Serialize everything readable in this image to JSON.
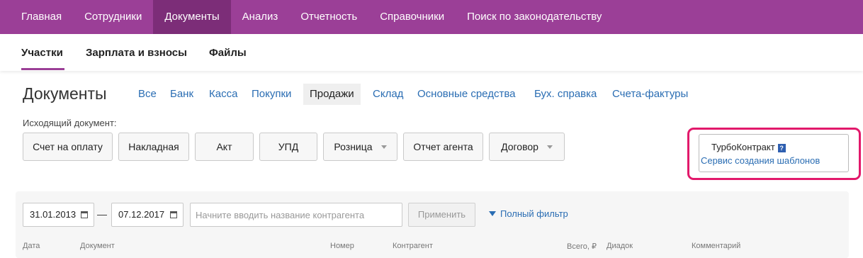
{
  "topnav": [
    "Главная",
    "Сотрудники",
    "Документы",
    "Анализ",
    "Отчетность",
    "Справочники",
    "Поиск по законодательству"
  ],
  "subnav": [
    "Участки",
    "Зарплата и взносы",
    "Файлы"
  ],
  "page_title": "Документы",
  "filters": [
    "Все",
    "Банк",
    "Касса",
    "Покупки",
    "Продажи",
    "Склад",
    "Основные средства",
    "Бух. справка",
    "Счета-фактуры"
  ],
  "active_filter": "Продажи",
  "outgoing_label": "Исходящий документ:",
  "buttons": [
    "Счет на оплату",
    "Накладная",
    "Акт",
    "УПД",
    "Розница",
    "Отчет агента",
    "Договор"
  ],
  "turbo": {
    "title": "ТурбоКонтракт",
    "help_glyph": "?",
    "link": "Сервис создания шаблонов"
  },
  "date_from": "31.01.2013",
  "date_sep": "—",
  "date_to": "07.12.2017",
  "search_placeholder": "Начните вводить название контрагента",
  "apply_label": "Применить",
  "full_filter_label": "Полный фильтр",
  "columns": [
    "Дата",
    "Документ",
    "Номер",
    "Контрагент",
    "Всего, ₽",
    "Диадок",
    "Комментарий"
  ],
  "colors": {
    "brand": "#9b3f97",
    "brand_active": "#7c2d78",
    "link": "#2a6db3",
    "highlight": "#e2196b"
  }
}
